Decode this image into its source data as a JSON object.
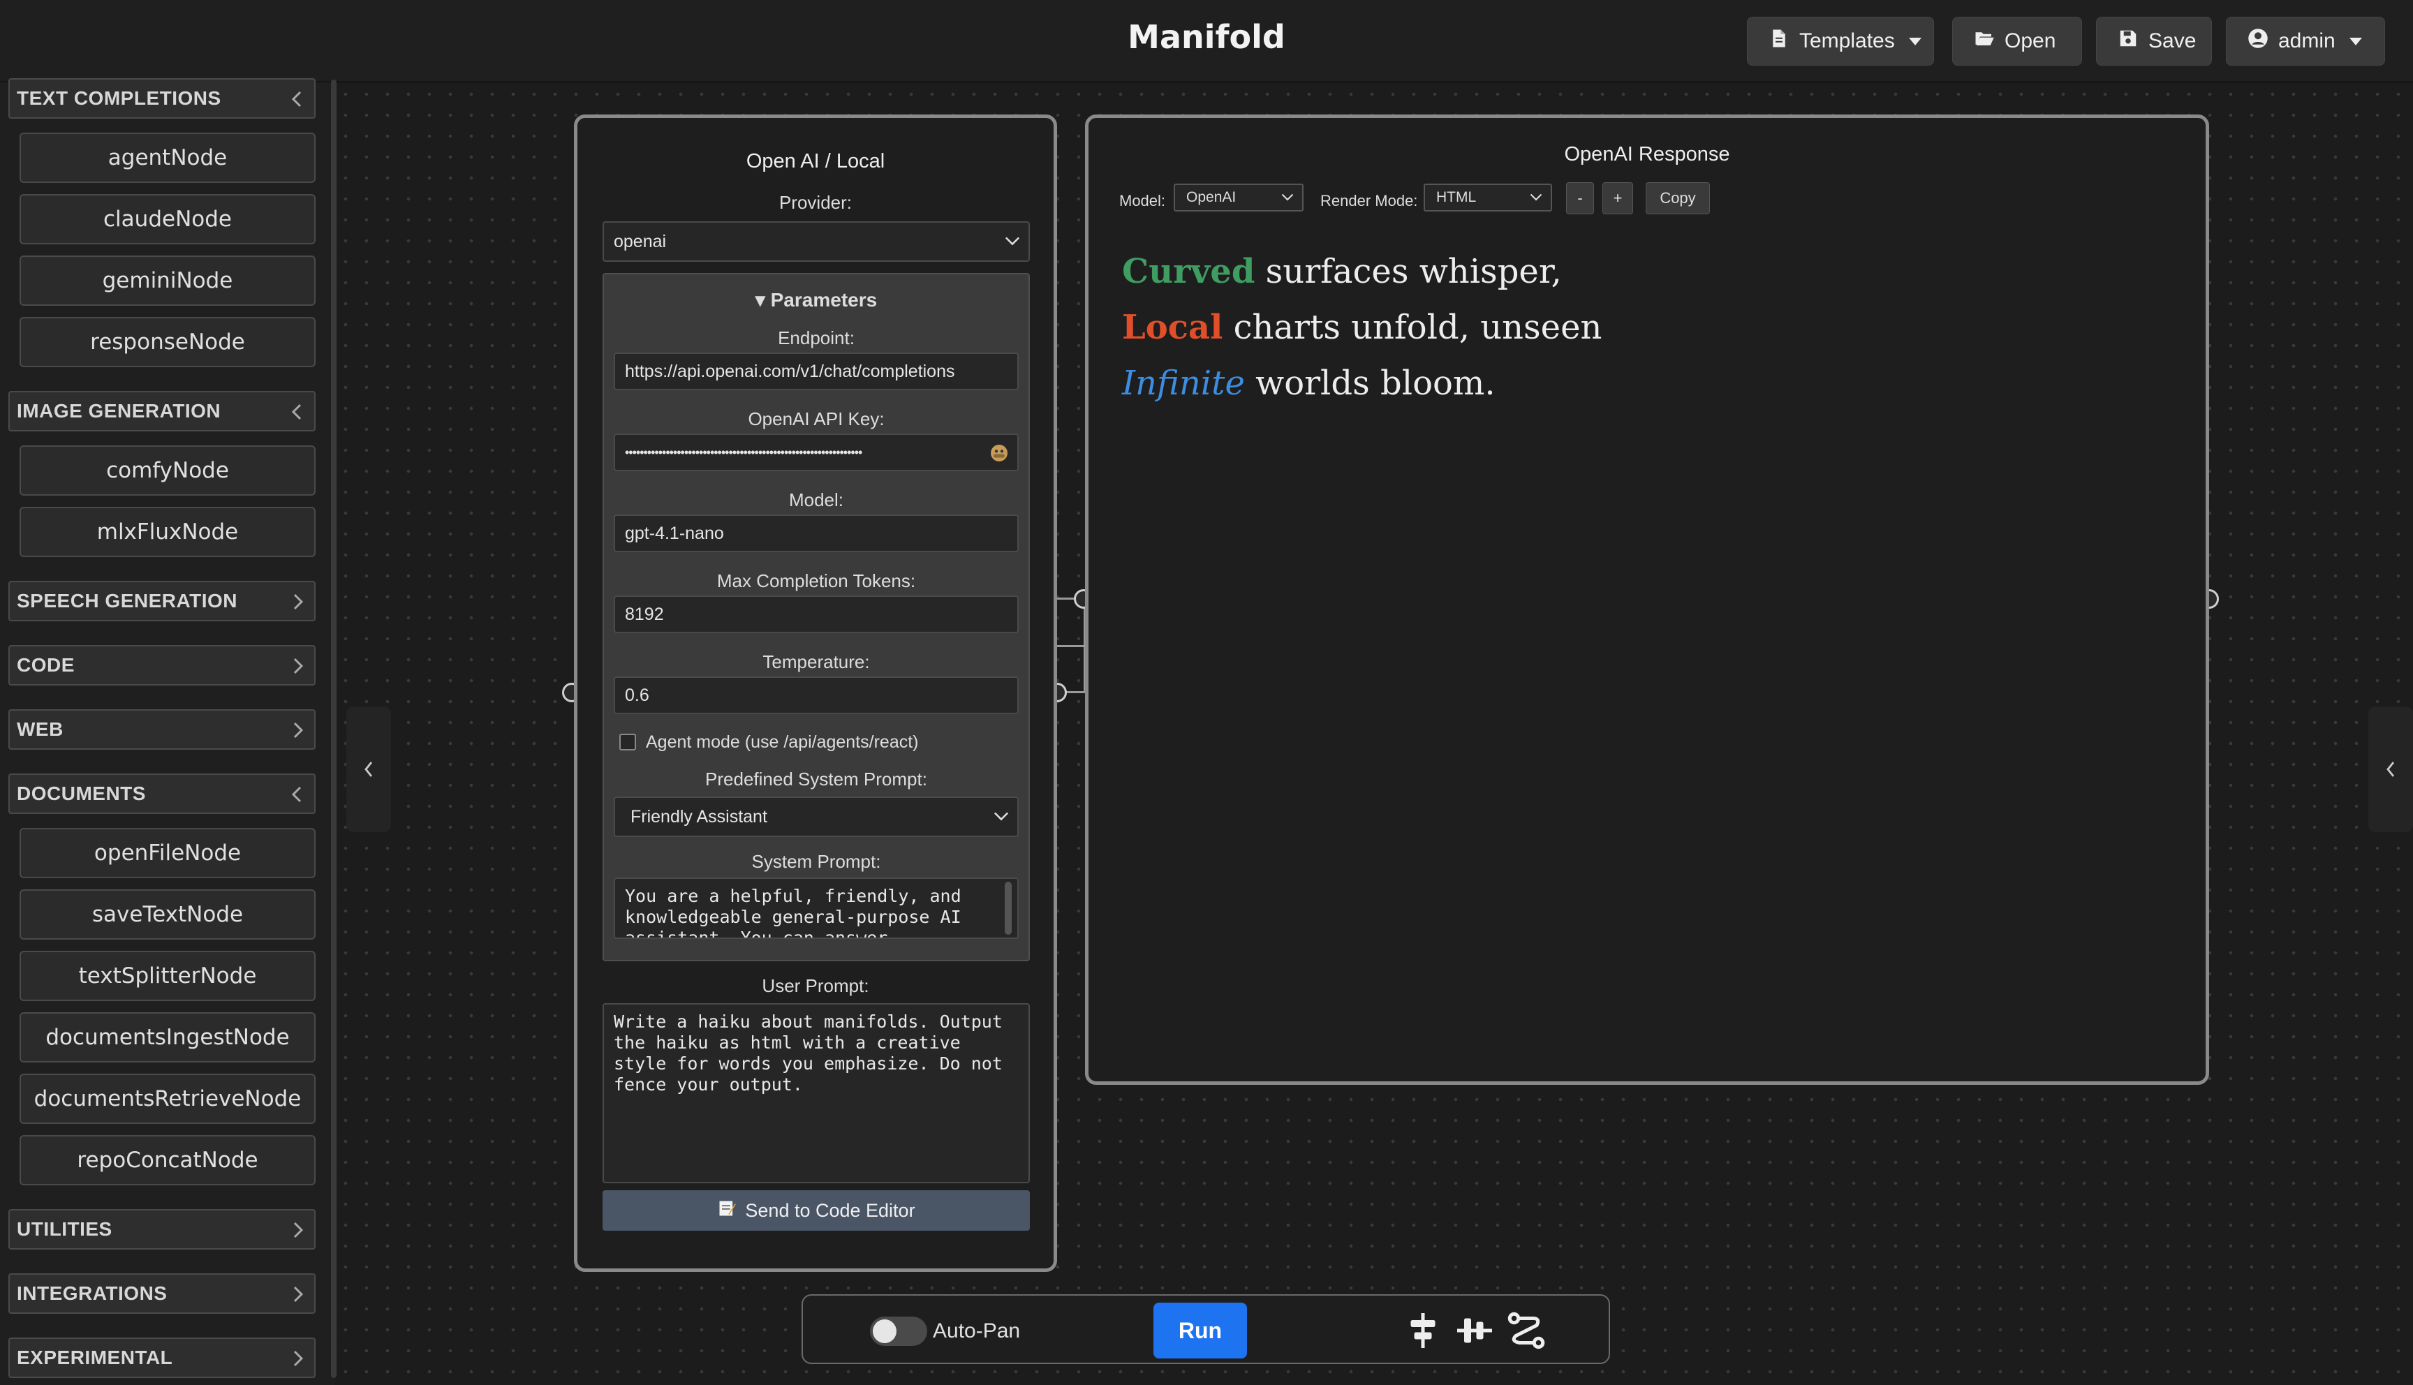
{
  "header": {
    "title": "Manifold",
    "templates_label": "Templates",
    "open_label": "Open",
    "save_label": "Save",
    "user_label": "admin"
  },
  "sidebar": {
    "categories": [
      {
        "label": "TEXT COMPLETIONS",
        "expanded": true,
        "items": [
          "agentNode",
          "claudeNode",
          "geminiNode",
          "responseNode"
        ]
      },
      {
        "label": "IMAGE GENERATION",
        "expanded": true,
        "items": [
          "comfyNode",
          "mlxFluxNode"
        ]
      },
      {
        "label": "SPEECH GENERATION",
        "expanded": false,
        "items": []
      },
      {
        "label": "CODE",
        "expanded": false,
        "items": []
      },
      {
        "label": "WEB",
        "expanded": false,
        "items": []
      },
      {
        "label": "DOCUMENTS",
        "expanded": true,
        "items": [
          "openFileNode",
          "saveTextNode",
          "textSplitterNode",
          "documentsIngestNode",
          "documentsRetrieveNode",
          "repoConcatNode"
        ]
      },
      {
        "label": "UTILITIES",
        "expanded": false,
        "items": []
      },
      {
        "label": "INTEGRATIONS",
        "expanded": false,
        "items": []
      },
      {
        "label": "EXPERIMENTAL",
        "expanded": false,
        "items": []
      }
    ]
  },
  "openai_node": {
    "title": "Open AI / Local",
    "provider_label": "Provider:",
    "provider_value": "openai",
    "params_label": "▾ Parameters",
    "endpoint_label": "Endpoint:",
    "endpoint_value": "https://api.openai.com/v1/chat/completions",
    "api_key_label": "OpenAI API Key:",
    "api_key_value": "••••••••••••••••••••••••••••••••••••••••••••••••••••••••••••••••",
    "model_label": "Model:",
    "model_value": "gpt-4.1-nano",
    "max_tokens_label": "Max Completion Tokens:",
    "max_tokens_value": "8192",
    "temperature_label": "Temperature:",
    "temperature_value": "0.6",
    "agent_mode_label": "Agent mode (use /api/agents/react)",
    "agent_mode_checked": false,
    "predefined_prompt_label": "Predefined System Prompt:",
    "predefined_prompt_value": "Friendly Assistant",
    "system_prompt_label": "System Prompt:",
    "system_prompt_value": "You are a helpful, friendly, and knowledgeable general-purpose AI assistant. You can answer",
    "user_prompt_label": "User Prompt:",
    "user_prompt_value": "Write a haiku about manifolds. Output the haiku as html with a creative style for words you emphasize. Do not fence your output.",
    "send_label": "Send to Code Editor"
  },
  "response_node": {
    "title": "OpenAI Response",
    "model_label": "Model:",
    "model_value": "OpenAI",
    "render_mode_label": "Render Mode:",
    "render_mode_value": "HTML",
    "minus_label": "-",
    "plus_label": "+",
    "copy_label": "Copy",
    "haiku": {
      "line1_emph": "Curved",
      "line1_rest": " surfaces whisper,",
      "line2_emph": "Local",
      "line2_rest": " charts unfold, unseen",
      "line3_emph": "Infinite",
      "line3_rest": " worlds bloom."
    }
  },
  "toolbar": {
    "autopan_label": "Auto-Pan",
    "autopan_on": false,
    "run_label": "Run"
  },
  "colors": {
    "accent": "#1e74f0",
    "curved": "#3f9d62",
    "local": "#e04f2a",
    "infinite": "#3d8de0"
  }
}
